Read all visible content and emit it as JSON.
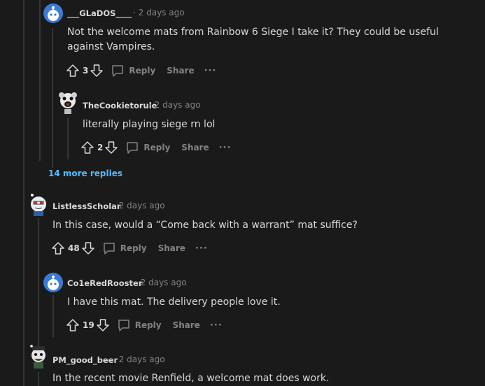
{
  "comments": [
    {
      "user": "___GLaDOS____",
      "time": "2 days ago",
      "text": "Not the welcome mats from Rainbow 6 Siege I take it? They could be useful against Vampires.",
      "score": "3"
    },
    {
      "user": "TheCookietorule",
      "time": "2 days ago",
      "text": "literally playing siege rn lol",
      "score": "2"
    },
    {
      "user": "ListlessScholar",
      "time": "2 days ago",
      "text": "In this case, would a “Come back with a warrant” mat suffice?",
      "score": "48"
    },
    {
      "user": "Co1eRedRooster",
      "time": "2 days ago",
      "text": "I have this mat. The delivery people love it.",
      "score": "19"
    },
    {
      "user": "PM_good_beer",
      "time": "2 days ago",
      "text": "In the recent movie Renfield, a welcome mat does work."
    }
  ],
  "more_replies": "14 more replies",
  "labels": {
    "reply": "Reply",
    "share": "Share",
    "more": "···",
    "sep": "·"
  },
  "colors": {
    "bg": "#1a1a1b",
    "text": "#d7dadc",
    "muted": "#818384",
    "link": "#4fbcff",
    "avatar_blue": "#3a7cd5"
  }
}
